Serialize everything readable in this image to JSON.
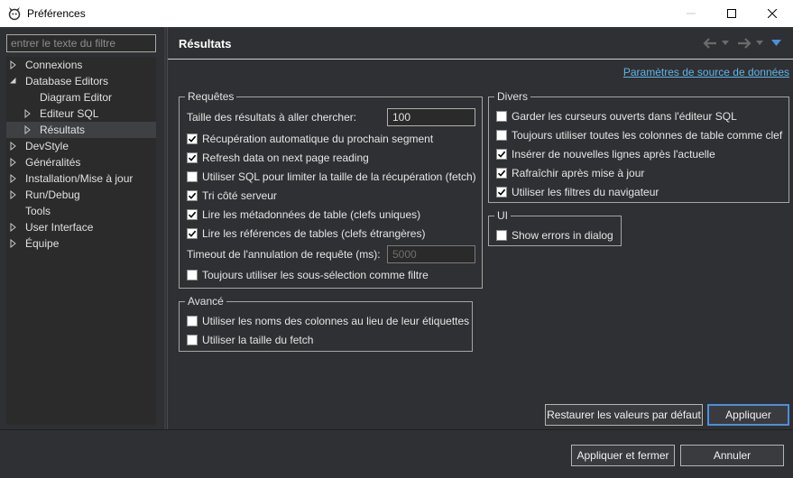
{
  "window": {
    "title": "Préférences",
    "app_icon": "eclipse-dbeaver-icon"
  },
  "filter": {
    "placeholder": "entrer le texte du filtre"
  },
  "tree": [
    {
      "label": "Connexions",
      "level": 0,
      "expandable": true,
      "expanded": false,
      "selected": false
    },
    {
      "label": "Database Editors",
      "level": 0,
      "expandable": true,
      "expanded": true,
      "selected": false
    },
    {
      "label": "Diagram Editor",
      "level": 1,
      "expandable": false,
      "expanded": false,
      "selected": false
    },
    {
      "label": "Editeur SQL",
      "level": 1,
      "expandable": true,
      "expanded": false,
      "selected": false
    },
    {
      "label": "Résultats",
      "level": 1,
      "expandable": true,
      "expanded": false,
      "selected": true
    },
    {
      "label": "DevStyle",
      "level": 0,
      "expandable": true,
      "expanded": false,
      "selected": false
    },
    {
      "label": "Généralités",
      "level": 0,
      "expandable": true,
      "expanded": false,
      "selected": false
    },
    {
      "label": "Installation/Mise à jour",
      "level": 0,
      "expandable": true,
      "expanded": false,
      "selected": false
    },
    {
      "label": "Run/Debug",
      "level": 0,
      "expandable": true,
      "expanded": false,
      "selected": false
    },
    {
      "label": "Tools",
      "level": 0,
      "expandable": false,
      "expanded": false,
      "selected": false
    },
    {
      "label": "User Interface",
      "level": 0,
      "expandable": true,
      "expanded": false,
      "selected": false
    },
    {
      "label": "Équipe",
      "level": 0,
      "expandable": true,
      "expanded": false,
      "selected": false
    }
  ],
  "page": {
    "title": "Résultats",
    "datasource_link": "Paramètres de source de données"
  },
  "requetes": {
    "title": "Requêtes",
    "fetch_size_label": "Taille des résultats à aller chercher:",
    "fetch_size_value": "100",
    "checks": [
      {
        "label": "Récupération automatique du prochain segment",
        "checked": true
      },
      {
        "label": "Refresh data on next page reading",
        "checked": true
      },
      {
        "label": "Utiliser SQL pour limiter la taille de la récupération (fetch)",
        "checked": false
      },
      {
        "label": "Tri côté serveur",
        "checked": true
      },
      {
        "label": "Lire les métadonnées de table (clefs uniques)",
        "checked": true
      },
      {
        "label": "Lire les références de tables (clefs étrangères)",
        "checked": true
      }
    ],
    "timeout_label": "Timeout de l'annulation de requête (ms):",
    "timeout_value": "5000",
    "subselect": {
      "label": "Toujours utiliser les sous-sélection comme filtre",
      "checked": false
    }
  },
  "avance": {
    "title": "Avancé",
    "checks": [
      {
        "label": "Utiliser les noms des colonnes au lieu de leur étiquettes",
        "checked": false
      },
      {
        "label": "Utiliser la taille du fetch",
        "checked": false
      }
    ]
  },
  "divers": {
    "title": "Divers",
    "checks": [
      {
        "label": "Garder les curseurs ouverts dans l'éditeur SQL",
        "checked": false
      },
      {
        "label": "Toujours utiliser toutes les colonnes de table comme clef",
        "checked": false
      },
      {
        "label": "Insérer de nouvelles lignes après l'actuelle",
        "checked": true
      },
      {
        "label": "Rafraîchir après mise à jour",
        "checked": true
      },
      {
        "label": "Utiliser les filtres du navigateur",
        "checked": true
      }
    ]
  },
  "ui": {
    "title": "UI",
    "checks": [
      {
        "label": "Show errors in dialog",
        "checked": false
      }
    ]
  },
  "buttons": {
    "restore_defaults": "Restaurer les valeurs par défaut",
    "apply": "Appliquer",
    "apply_close": "Appliquer et fermer",
    "cancel": "Annuler"
  },
  "colors": {
    "link": "#5eb3ea",
    "accent_button": "#4d8fd9",
    "nav_menu": "#4d8fd9",
    "background": "#2f3033"
  }
}
